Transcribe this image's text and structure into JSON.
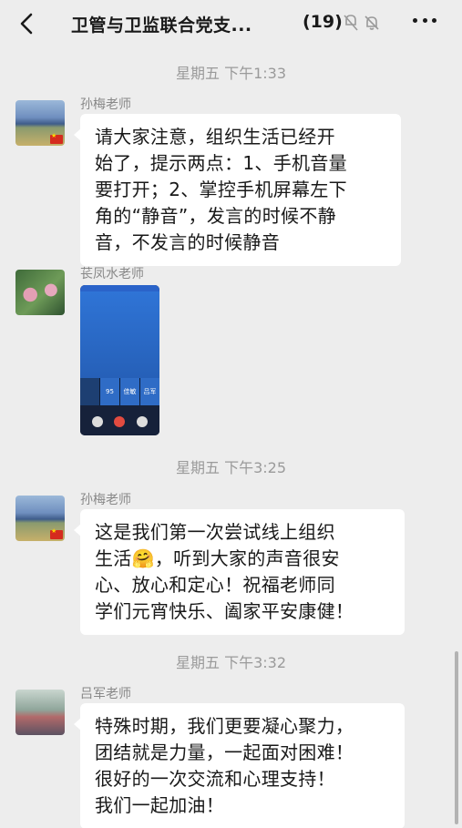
{
  "header": {
    "title": "卫管与卫监联合党支...",
    "member_count": "(19)",
    "back_icon": "chevron-left-icon",
    "mute_icon": "mute-icon",
    "bell_off_icon": "bell-off-icon",
    "more_icon": "more-dots-icon"
  },
  "timestamps": [
    "星期五 下午1:33",
    "星期五 下午3:25",
    "星期五 下午3:32"
  ],
  "messages": [
    {
      "sender": "孙梅老师",
      "text": "请大家注意，组织生活已经开\n始了，提示两点：1、手机音量\n要打开；2、掌控手机屏幕左下\n角的“静音”，发言的时候不静\n音，不发言的时候静音"
    },
    {
      "sender": "苌凤水老师",
      "image": {
        "tiles": [
          "",
          "95",
          "佳敏",
          "吕军"
        ]
      }
    },
    {
      "sender": "孙梅老师",
      "text": "这是我们第一次尝试线上组织\n生活🤗，听到大家的声音很安\n心、放心和定心！祝福老师同\n学们元宵快乐、阖家平安康健！"
    },
    {
      "sender": "吕军老师",
      "text": "特殊时期，我们更要凝心聚力，\n团结就是力量，一起面对困难！\n很好的一次交流和心理支持！\n我们一起加油！"
    }
  ]
}
